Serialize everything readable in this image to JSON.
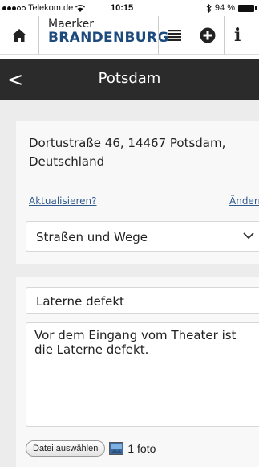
{
  "status_bar": {
    "carrier": "Telekom.de",
    "time": "10:15",
    "battery": "94 %"
  },
  "header": {
    "logo_line1": "Maerker",
    "logo_line2": "BRANDENBURG",
    "info_label": "i"
  },
  "titlebar": {
    "back_glyph": "<",
    "title": "Potsdam"
  },
  "location": {
    "address": "Dortustraße 46, 14467 Potsdam, Deutschland",
    "update_link": "Aktualisieren?",
    "change_link": "Ändern?"
  },
  "category": {
    "selected": "Straßen und Wege"
  },
  "report": {
    "title_value": "Laterne defekt",
    "description_value": "Vor dem Eingang vom Theater ist die Laterne defekt.",
    "file_button": "Datei auswählen",
    "file_count": "1 foto"
  },
  "colors": {
    "brand_blue": "#1d4a7d",
    "titlebar_bg": "#2b2b2b",
    "link": "#2f5a8c",
    "content_bg": "#ececec"
  },
  "icons": [
    "wifi-icon",
    "bluetooth-icon",
    "battery-icon",
    "home-icon",
    "menu-icon",
    "add-circle-icon",
    "info-icon",
    "back-icon",
    "chevron-down-icon",
    "image-icon"
  ]
}
